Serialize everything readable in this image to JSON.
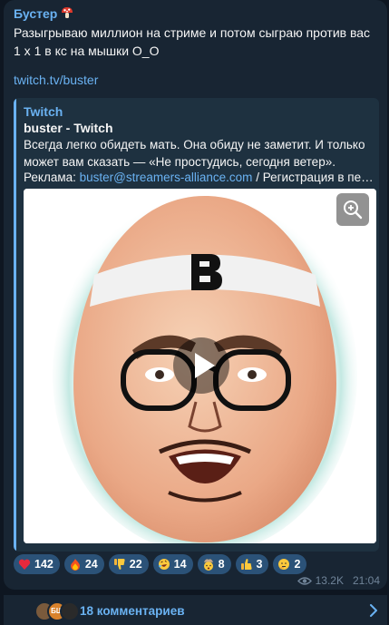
{
  "post": {
    "author": "Бустер",
    "author_icon": "mushroom-emoji",
    "text": "Разыгрываю миллион на стриме и потом сыграю против вас 1 х 1 в кс на мышки О_О",
    "link": "twitch.tv/buster"
  },
  "preview": {
    "site_name": "Twitch",
    "title": "buster - Twitch",
    "description": "Всегда легко обидеть мать. Она обиду не заметит. И только может вам сказать — «Не простудись, сегодня ветер».",
    "ad_label": "Реклама: ",
    "ad_email": "buster@streamers-alliance.com",
    "ad_rest": " / Регистрация в пере...",
    "media": {
      "type": "video-thumbnail",
      "logo_letter": "B",
      "zoom_icon": "zoom-in-icon",
      "play_icon": "play-icon"
    }
  },
  "reactions": [
    {
      "emoji": "red-heart",
      "count": "142"
    },
    {
      "emoji": "fire",
      "count": "24"
    },
    {
      "emoji": "thumbs-down",
      "count": "22"
    },
    {
      "emoji": "rofl",
      "count": "14"
    },
    {
      "emoji": "exploding-head",
      "count": "8"
    },
    {
      "emoji": "thumbs-up",
      "count": "3"
    },
    {
      "emoji": "thinking-face",
      "count": "2"
    }
  ],
  "meta": {
    "views": "13.2K",
    "time": "21:04"
  },
  "comments": {
    "label": "18 комментариев",
    "avatars": [
      {
        "text": "",
        "color": "#7a5a3c"
      },
      {
        "text": "БШ",
        "color": "#d9822b"
      },
      {
        "text": "",
        "color": "#2a2a2a"
      }
    ]
  },
  "colors": {
    "background": "#0e1621",
    "bubble": "#182533",
    "accent": "#6ab2f2",
    "reaction_bg": "#2b5278",
    "meta": "#708499"
  }
}
